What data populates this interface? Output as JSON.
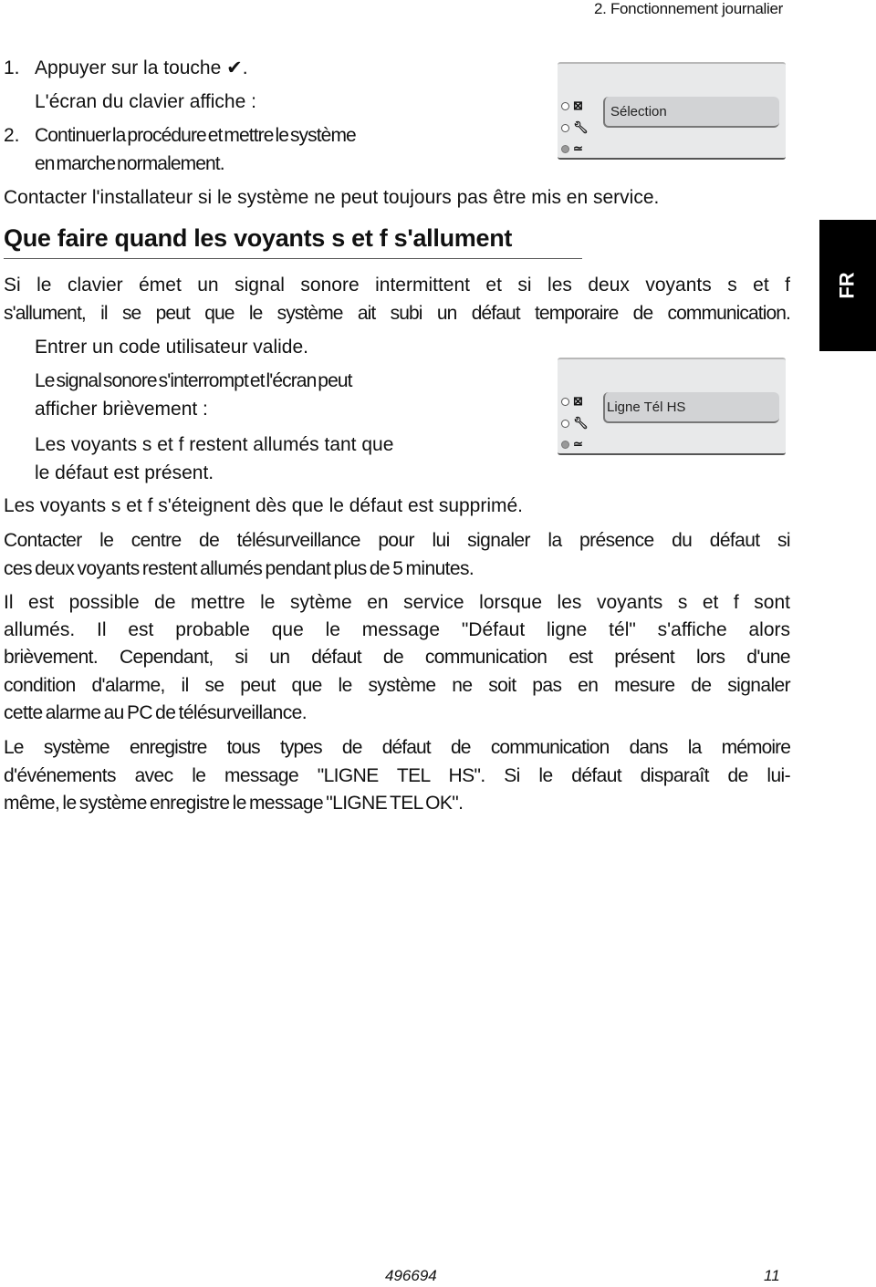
{
  "header": {
    "running_title": "2. Fonctionnement journalier"
  },
  "steps_top": {
    "step1_number": "1.",
    "step1_text": "Appuyer sur la touche ✔.",
    "step1_sub": "L'écran du clavier affiche :",
    "step2_number": "2.",
    "step2_line1": "Continuer la procédure et mettre le système",
    "step2_line2": "en marche normalement.",
    "contact_installer": "Contacter l'installateur si le système ne peut toujours pas être mis en service."
  },
  "keypad_1": {
    "display_text": "Sélection",
    "icons": [
      "tamper-icon",
      "wrench-icon",
      "power-icon"
    ],
    "leds": [
      "off",
      "off",
      "on"
    ]
  },
  "section": {
    "heading": "Que faire quand les voyants s et f s'allument",
    "intro_line1": "Si le clavier émet un signal sonore intermittent et si les deux voyants s et f",
    "intro_line2": "s'allument, il se peut que le système ait subi un défaut temporaire de communication.",
    "step_enter_code": "Entrer un code utilisateur valide.",
    "step_signal_line1": "Le signal sonore s'interrompt et l'écran peut",
    "step_signal_line2": "afficher brièvement :",
    "step_leds_line1": "Les voyants s et f restent allumés tant que",
    "step_leds_line2": "le défaut est présent.",
    "leds_off": "Les voyants s et f s'éteignent dès que le défaut est supprimé.",
    "contact_center_line1": "Contacter le centre de télésurveillance pour lui signaler la présence du défaut si",
    "contact_center_line2": "ces deux voyants restent allumés pendant plus de 5 minutes.",
    "possible_line1": "Il est possible de mettre le sytème en service lorsque les voyants s et f sont",
    "possible_line2": "allumés. Il est probable que le message \"Défaut ligne tél\" s'affiche alors",
    "possible_line3": "brièvement. Cependant, si un défaut de communication est présent lors d'une",
    "possible_line4": "condition d'alarme, il se peut que le système ne soit pas en mesure de signaler",
    "possible_line5": "cette alarme au PC de télésurveillance.",
    "log_line1": "Le système enregistre tous types de défaut de communication dans la mémoire",
    "log_line2": "d'événements avec le message \"LIGNE TEL HS\". Si le défaut disparaît de lui-",
    "log_line3": "même, le système enregistre le message \"LIGNE TEL OK\"."
  },
  "keypad_2": {
    "display_text": "Ligne Tél HS",
    "icons": [
      "tamper-icon",
      "wrench-icon",
      "power-icon"
    ],
    "leds": [
      "off",
      "off",
      "on"
    ]
  },
  "language_tab": {
    "label": "FR"
  },
  "footer": {
    "doc_number": "496694",
    "page_number": "11"
  }
}
